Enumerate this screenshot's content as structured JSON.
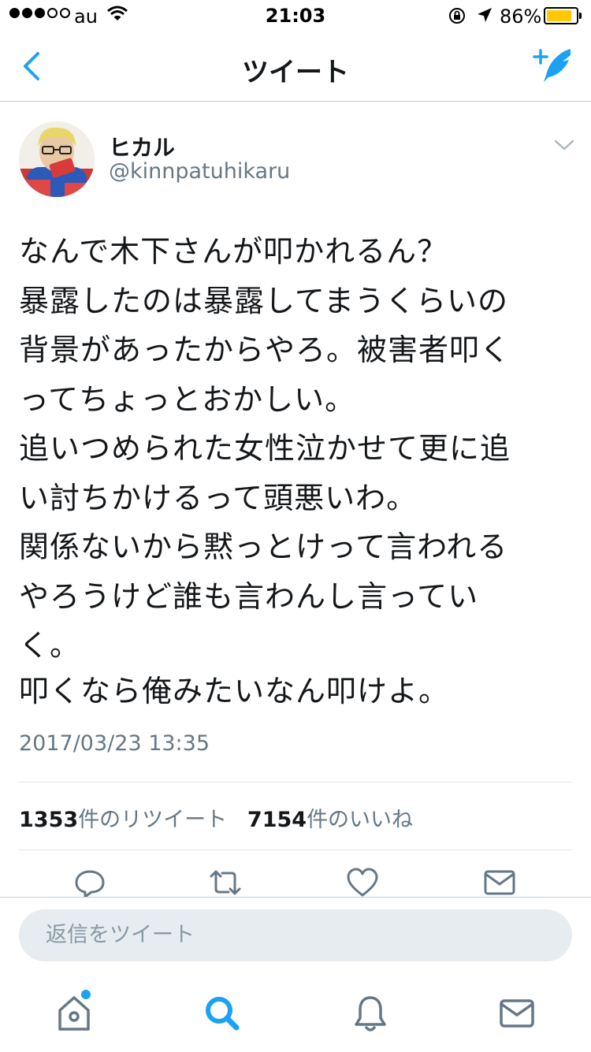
{
  "status_bar": {
    "carrier": "au",
    "time": "21:03",
    "battery_percent": "86%",
    "battery_level": 0.86,
    "signal_bars_filled": 3,
    "signal_bars_total": 5
  },
  "nav": {
    "title": "ツイート",
    "back_icon": "chevron-left-icon",
    "compose_icon": "compose-tweet-icon"
  },
  "tweet": {
    "author_name": "ヒカル",
    "author_handle": "@kinnpatuhikaru",
    "lines": [
      "なんで木下さんが叩かれるん？",
      "暴露したのは暴露してまうくらいの",
      "背景があったからやろ。被害者叩く",
      "ってちょっとおかしい。",
      "追いつめられた女性泣かせて更に追",
      "い討ちかけるって頭悪いわ。",
      "関係ないから黙っとけって言われる",
      "やろうけど誰も言わんし言ってい",
      "く。"
    ],
    "last_line": "叩くなら俺みたいなん叩けよ。",
    "timestamp": "2017/03/23 13:35",
    "retweet_count": "1353",
    "retweet_label": "件のリツイート",
    "like_count": "7154",
    "like_label": "件のいいね"
  },
  "reply": {
    "placeholder": "返信をツイート"
  },
  "colors": {
    "accent": "#1da1f2",
    "text": "#14171a",
    "secondary": "#657786",
    "input_bg": "#e6ecf0",
    "battery": "#ffc800"
  }
}
